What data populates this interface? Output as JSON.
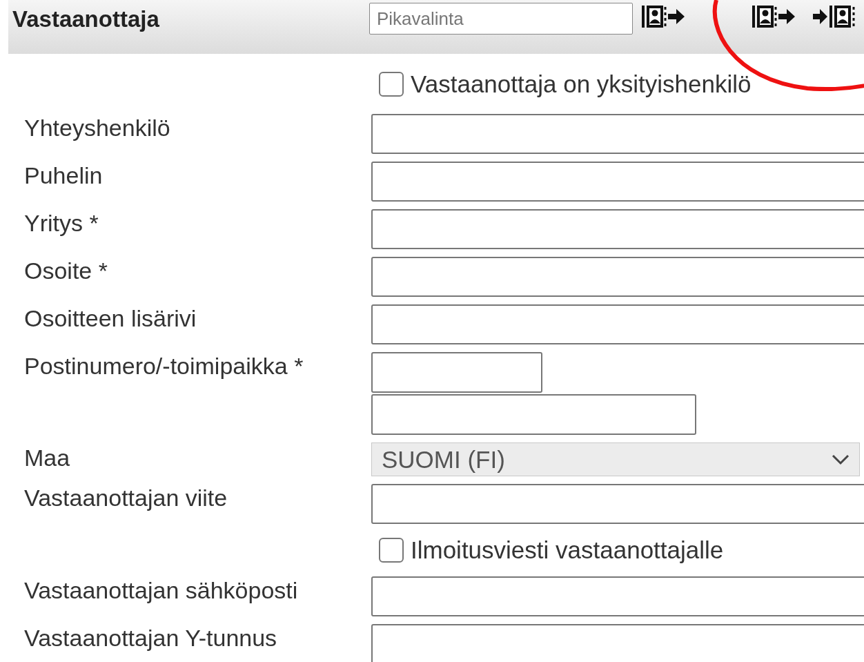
{
  "header": {
    "title": "Vastaanottaja",
    "quick_select": {
      "placeholder": "Pikavalinta"
    }
  },
  "rows": [
    {
      "kind": "checkbox",
      "label": "Vastaanottaja on yksityishenkilö",
      "checked": false
    },
    {
      "kind": "text",
      "label": "Yhteyshenkilö"
    },
    {
      "kind": "text",
      "label": "Puhelin"
    },
    {
      "kind": "text",
      "label": "Yritys *"
    },
    {
      "kind": "text",
      "label": "Osoite *"
    },
    {
      "kind": "text",
      "label": "Osoitteen lisärivi"
    },
    {
      "kind": "postal",
      "label": "Postinumero/-toimipaikka *"
    },
    {
      "kind": "select",
      "label": "Maa",
      "value": "SUOMI (FI)"
    },
    {
      "kind": "text",
      "label": "Vastaanottajan viite"
    },
    {
      "kind": "checkbox",
      "label": "Ilmoitusviesti vastaanottajalle",
      "checked": false
    },
    {
      "kind": "text",
      "label": "Vastaanottajan sähköposti"
    },
    {
      "kind": "text",
      "label": "Vastaanottajan Y-tunnus"
    }
  ]
}
